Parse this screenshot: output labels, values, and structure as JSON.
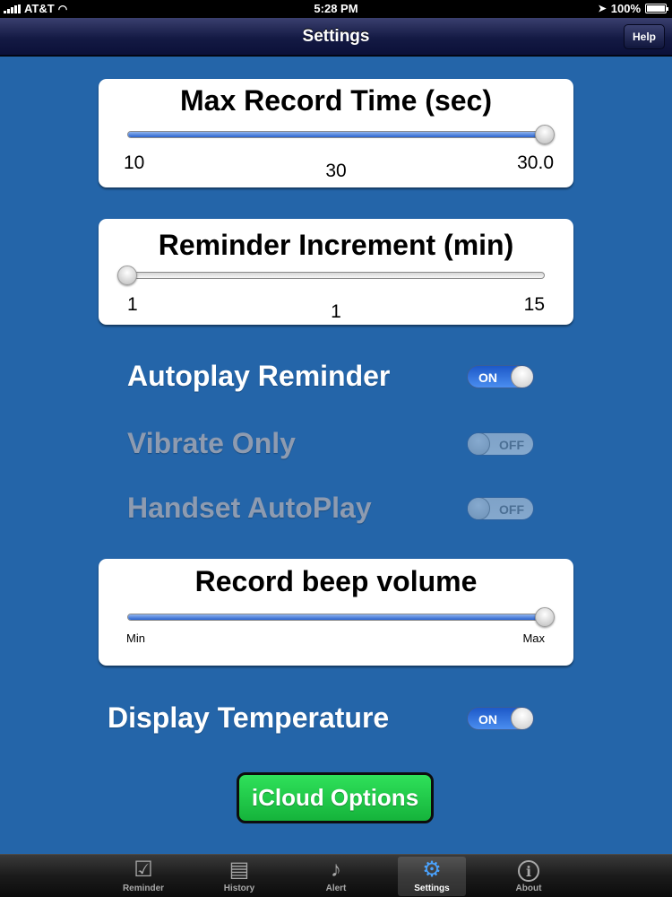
{
  "status": {
    "carrier": "AT&T",
    "time": "5:28 PM",
    "battery": "100%"
  },
  "nav": {
    "title": "Settings",
    "help_label": "Help"
  },
  "max_record": {
    "title": "Max Record Time (sec)",
    "min_label": "10",
    "current_label": "30",
    "max_label": "30.0",
    "value_fraction": 1.0
  },
  "reminder_increment": {
    "title": "Reminder Increment (min)",
    "min_label": "1",
    "current_label": "1",
    "max_label": "15",
    "value_fraction": 0.0
  },
  "toggles": {
    "autoplay": {
      "label": "Autoplay Reminder",
      "state": "ON"
    },
    "vibrate": {
      "label": "Vibrate Only",
      "state": "OFF"
    },
    "handset": {
      "label": "Handset AutoPlay",
      "state": "OFF"
    },
    "temperature": {
      "label": "Display Temperature",
      "state": "ON"
    }
  },
  "beep_volume": {
    "title": "Record beep volume",
    "min_label": "Min",
    "max_label": "Max",
    "value_fraction": 1.0
  },
  "icloud": {
    "label": "iCloud Options"
  },
  "tabs": [
    {
      "label": "Reminder",
      "icon": "checkbox-icon"
    },
    {
      "label": "History",
      "icon": "notepad-icon"
    },
    {
      "label": "Alert",
      "icon": "music-note-icon"
    },
    {
      "label": "Settings",
      "icon": "gear-icon"
    },
    {
      "label": "About",
      "icon": "info-icon"
    }
  ],
  "colors": {
    "background": "#2465a9",
    "nav": "#141a44",
    "switch_on": "#2a6fe0",
    "icloud_button": "#1fc548"
  }
}
